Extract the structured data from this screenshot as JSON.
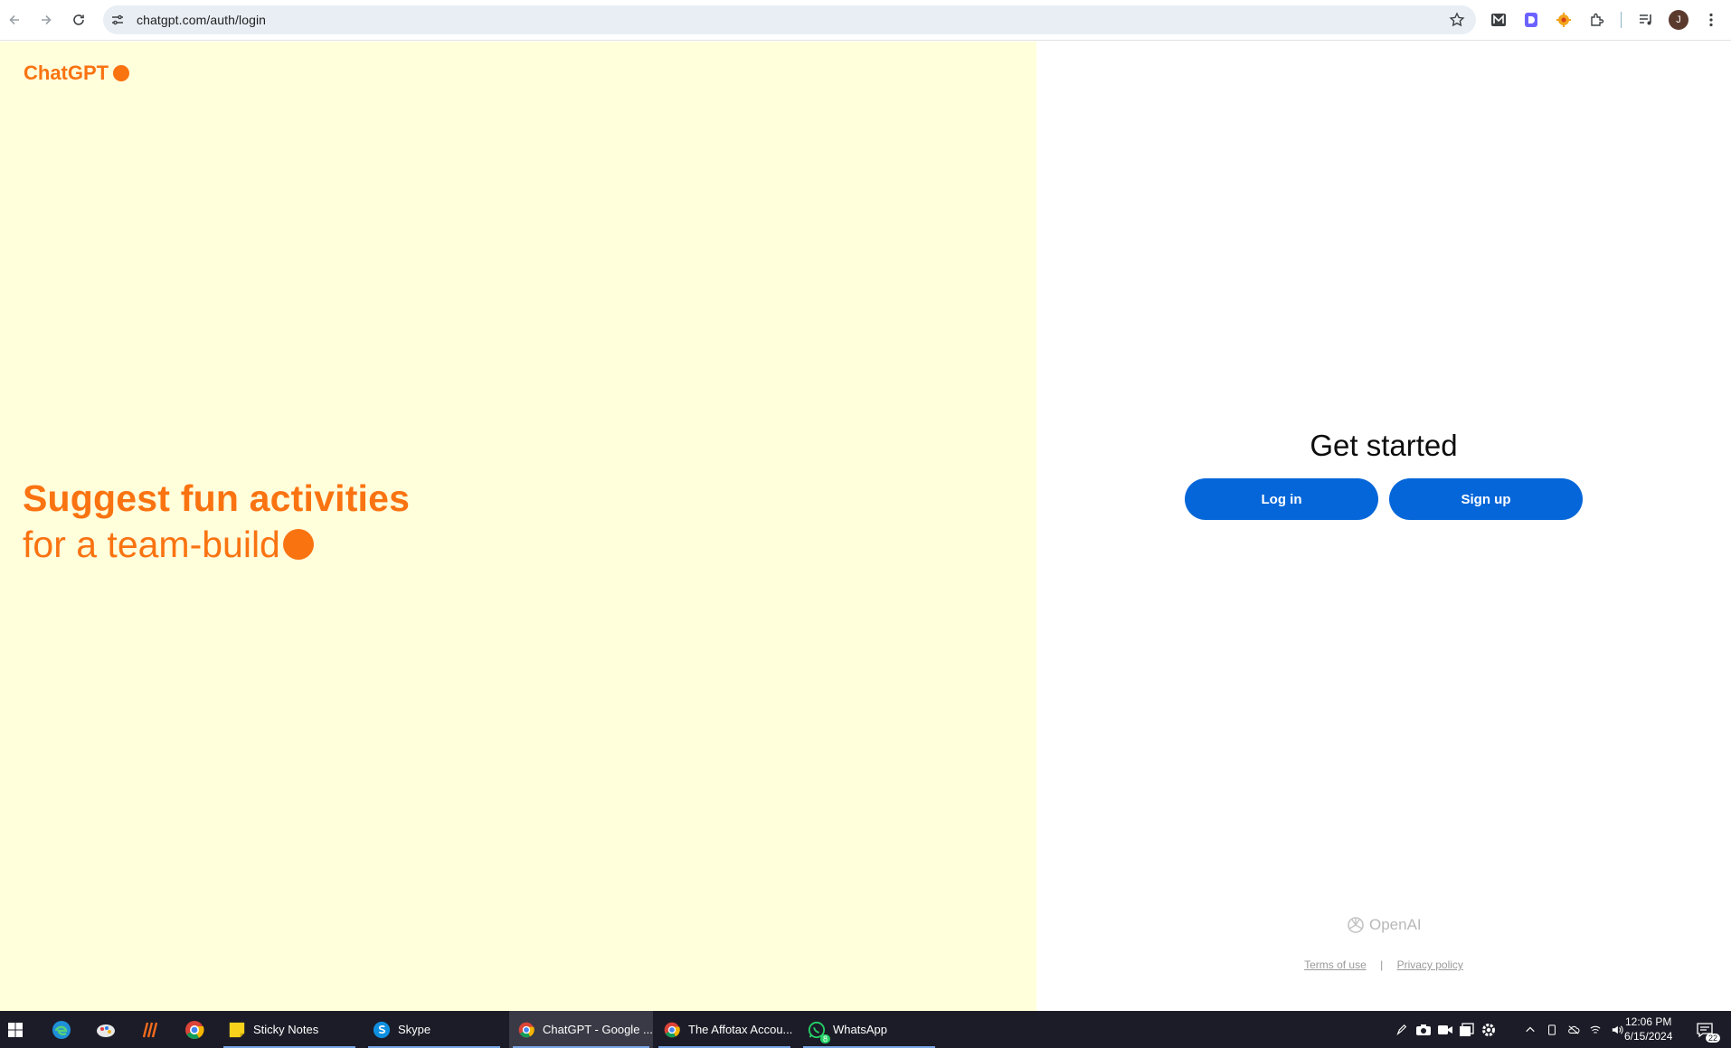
{
  "browser": {
    "url": "chatgpt.com/auth/login",
    "profile_initial": "J"
  },
  "page": {
    "brand": "ChatGPT",
    "hero_line1": "Suggest fun activities",
    "hero_line2": "for a team-build",
    "heading": "Get started",
    "login_label": "Log in",
    "signup_label": "Sign up",
    "footer_brand": "OpenAI",
    "terms_label": "Terms of use",
    "separator": "|",
    "privacy_label": "Privacy policy"
  },
  "colors": {
    "accent": "#fa7311",
    "left_bg": "#ffffdc",
    "button": "#0566d9"
  },
  "taskbar": {
    "apps": [
      {
        "label": "Sticky Notes",
        "icon": "sticky-notes-icon"
      },
      {
        "label": "Skype",
        "icon": "skype-icon"
      },
      {
        "label": "ChatGPT - Google ...",
        "icon": "chrome-icon",
        "active": true
      },
      {
        "label": "The Affotax Accou...",
        "icon": "chrome-icon"
      },
      {
        "label": "WhatsApp",
        "icon": "whatsapp-icon",
        "badge": "8"
      }
    ],
    "time": "12:06 PM",
    "date": "6/15/2024",
    "notification_count": "22"
  }
}
